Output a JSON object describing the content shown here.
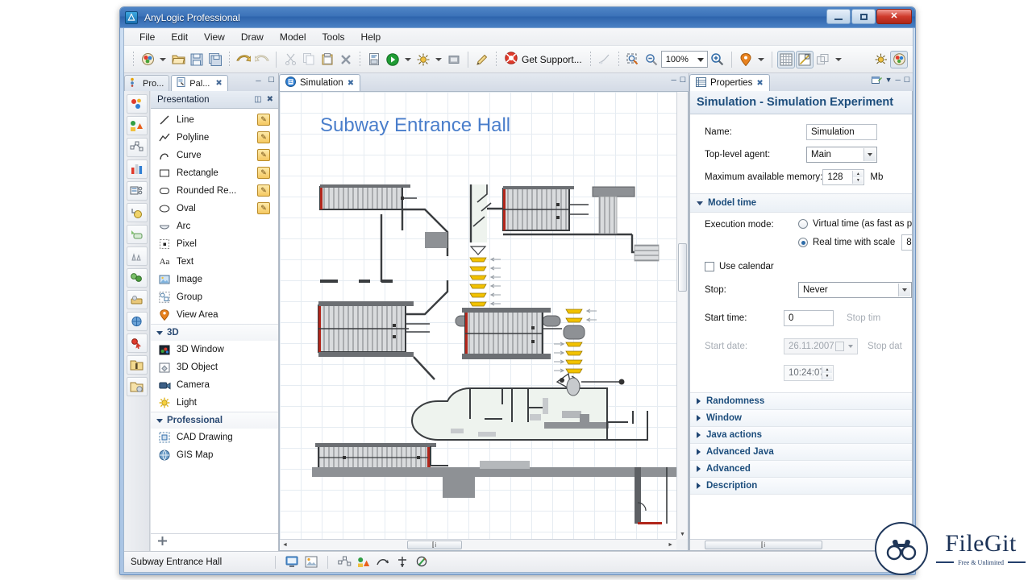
{
  "window": {
    "title": "AnyLogic Professional",
    "app_icon": "anylogic-logo-icon",
    "minimize": "–",
    "maximize": "□",
    "close": "✕"
  },
  "menubar": {
    "items": [
      "File",
      "Edit",
      "View",
      "Draw",
      "Model",
      "Tools",
      "Help"
    ]
  },
  "toolbar": {
    "get_support_label": "Get Support...",
    "zoom_value": "100%",
    "groups": [
      {
        "name": "new",
        "icons": [
          "new-model-icon",
          "dropdown-caret",
          "open-icon",
          "save-icon",
          "save-all-icon"
        ]
      },
      {
        "name": "history",
        "icons": [
          "undo-icon",
          "redo-icon"
        ]
      },
      {
        "name": "clipboard",
        "icons": [
          "cut-icon",
          "copy-icon",
          "paste-icon",
          "delete-icon"
        ]
      },
      {
        "name": "run",
        "icons": [
          "build-icon",
          "run-icon",
          "dropdown-caret",
          "debug-icon",
          "dropdown-caret",
          "terminate-icon"
        ]
      },
      {
        "name": "tools",
        "icons": [
          "pencil-icon"
        ]
      },
      {
        "name": "support",
        "icons": [
          "lifebuoy-icon"
        ]
      },
      {
        "name": "view",
        "icons": [
          "route-icon",
          "zoom-region-icon",
          "zoom-out-icon"
        ]
      },
      {
        "name": "zoomin",
        "icons": [
          "zoom-in-icon"
        ]
      },
      {
        "name": "marker",
        "icons": [
          "marker-icon",
          "dropdown-caret"
        ]
      },
      {
        "name": "grid",
        "icons": [
          "grid-icon",
          "snap-icon",
          "layers-icon",
          "dropdown-caret"
        ]
      },
      {
        "name": "right",
        "icons": [
          "debug-perspective-icon",
          "modeling-perspective-icon"
        ]
      }
    ]
  },
  "left_panel": {
    "tabs": [
      {
        "label": "Pro...",
        "icon": "projects-icon",
        "active": false
      },
      {
        "label": "Pal...",
        "icon": "palette-icon",
        "active": true
      }
    ],
    "tab_close": "✖",
    "minimize": "─",
    "maximize": "❐",
    "palette": {
      "header": "Presentation",
      "header_icons": [
        "grid-view-icon",
        "close-icon"
      ],
      "items": [
        {
          "label": "Line",
          "icon": "line-icon",
          "pen": true
        },
        {
          "label": "Polyline",
          "icon": "polyline-icon",
          "pen": true
        },
        {
          "label": "Curve",
          "icon": "curve-icon",
          "pen": true
        },
        {
          "label": "Rectangle",
          "icon": "rectangle-icon",
          "pen": true
        },
        {
          "label": "Rounded Re...",
          "icon": "rounded-rect-icon",
          "pen": true
        },
        {
          "label": "Oval",
          "icon": "oval-icon",
          "pen": true
        },
        {
          "label": "Arc",
          "icon": "arc-icon",
          "pen": false
        },
        {
          "label": "Pixel",
          "icon": "pixel-icon",
          "pen": false
        },
        {
          "label": "Text",
          "icon": "text-icon",
          "pen": false
        },
        {
          "label": "Image",
          "icon": "image-icon",
          "pen": false
        },
        {
          "label": "Group",
          "icon": "group-icon",
          "pen": false
        },
        {
          "label": "View Area",
          "icon": "view-area-icon",
          "pen": false
        }
      ],
      "groups": [
        {
          "title": "3D",
          "items": [
            {
              "label": "3D Window",
              "icon": "3d-window-icon"
            },
            {
              "label": "3D Object",
              "icon": "3d-object-icon"
            },
            {
              "label": "Camera",
              "icon": "camera-icon"
            },
            {
              "label": "Light",
              "icon": "light-icon"
            }
          ]
        },
        {
          "title": "Professional",
          "items": [
            {
              "label": "CAD Drawing",
              "icon": "cad-drawing-icon"
            },
            {
              "label": "GIS Map",
              "icon": "gis-map-icon"
            }
          ]
        }
      ],
      "footer_icon": "add-palette-icon",
      "rail_icons": [
        "agent-icon",
        "presentation-icon",
        "process-modeling-icon",
        "statistics-icon",
        "analysis-icon",
        "controls-icon",
        "connectivity-icon",
        "pedestrian-icon",
        "rail-library-icon",
        "fluid-library-icon",
        "material-handling-icon",
        "road-traffic-icon",
        "project-folder-icon",
        "extra-folder-icon"
      ]
    }
  },
  "editor": {
    "tab": {
      "label": "Simulation",
      "icon": "simulation-experiment-icon",
      "close": "✖"
    },
    "controls": [
      "minimize-icon",
      "maximize-icon"
    ],
    "canvas_title": "Subway Entrance Hall",
    "hscroll_grip": "⫿i",
    "scroll_left": "◄",
    "scroll_right": "►",
    "scroll_down": "▼"
  },
  "properties": {
    "tab": {
      "label": "Properties",
      "icon": "properties-icon",
      "close": "✖"
    },
    "header_icons": [
      "pin-editor-icon",
      "view-menu-icon",
      "minimize-icon",
      "maximize-icon"
    ],
    "title": "Simulation - Simulation Experiment",
    "fields": [
      {
        "label": "Name:",
        "value": "Simulation",
        "type": "text"
      },
      {
        "label": "Top-level agent:",
        "value": "Main",
        "type": "combo"
      },
      {
        "label": "Maximum available memory:",
        "value": "128",
        "type": "spinner",
        "unit": "Mb"
      }
    ],
    "model_time": {
      "section_title": "Model time",
      "execution_mode_label": "Execution mode:",
      "option_virtual": "Virtual time (as fast as po",
      "option_realtime": "Real time with scale",
      "realtime_scale_value": "8",
      "selected": "realtime",
      "use_calendar_label": "Use calendar",
      "use_calendar_checked": false,
      "stop_label": "Stop:",
      "stop_value": "Never",
      "start_time_label": "Start time:",
      "start_time_value": "0",
      "stop_time_label": "Stop tim",
      "start_date_label": "Start date:",
      "start_date_value": "26.11.2007",
      "stop_date_label": "Stop dat",
      "start_clock_value": "10:24:07"
    },
    "collapsed_sections": [
      "Randomness",
      "Window",
      "Java actions",
      "Advanced Java",
      "Advanced",
      "Description"
    ],
    "hscroll_grip": "⫿i"
  },
  "statusbar": {
    "text": "Subway Entrance Hall",
    "icons": [
      "presentation-view-icon",
      "model-image-icon",
      "flowchart-icon",
      "environment-icon",
      "curve-tool-icon",
      "axis-tool-icon",
      "pointer-tool-icon"
    ]
  },
  "watermark": {
    "brand": "FileGit",
    "tagline": "Free & Unlimited",
    "icon": "binoculars-icon"
  },
  "colors": {
    "accent_blue": "#2d63ab",
    "title_blue": "#1c4d7c",
    "canvas_title": "#4a7ecb",
    "escalator_yellow": "#f2c200",
    "wall_gray": "#8a8a8a",
    "close_red": "#cf3a2c"
  }
}
